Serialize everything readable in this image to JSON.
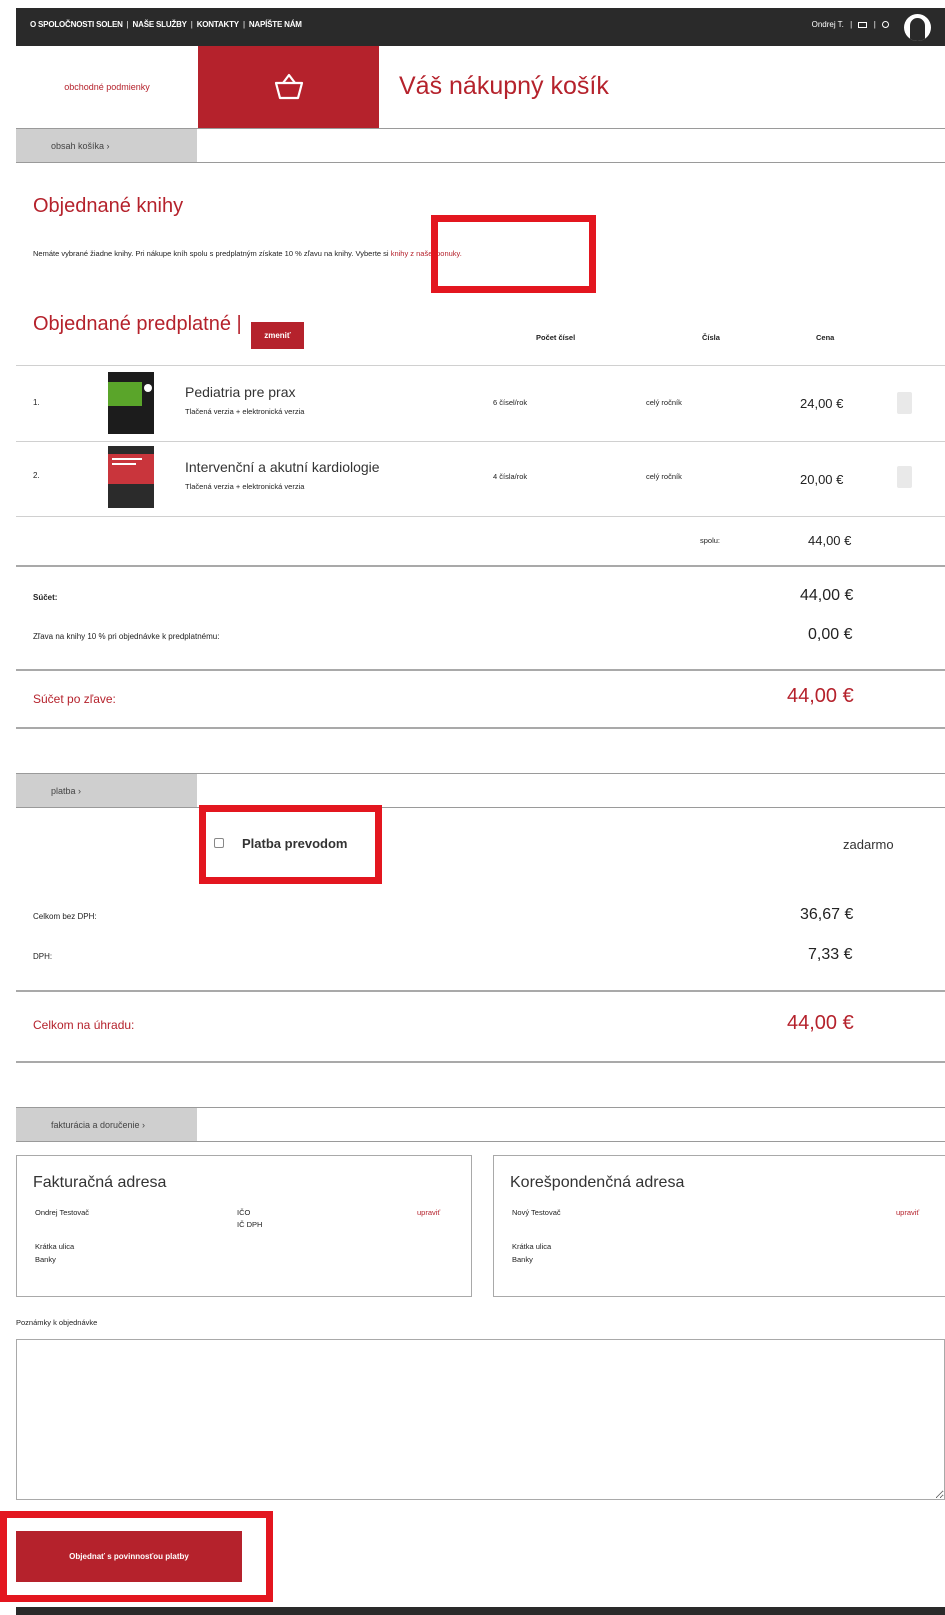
{
  "topbar": {
    "nav": [
      "O SPOLOČNOSTI SOLEN",
      "NAŠE SLUŽBY",
      "KONTAKTY",
      "NAPÍŠTE NÁM"
    ],
    "user": "Ondrej T.",
    "icons": [
      "cart-icon",
      "logout-icon"
    ],
    "separator": "|"
  },
  "header": {
    "terms_link": "obchodné podmienky",
    "title": "Váš nákupný košík"
  },
  "cart_tab": "obsah košíka ›",
  "books": {
    "title": "Objednané knihy",
    "notice_prefix": "Nemáte vybrané žiadne knihy. Pri nákupe kníh spolu s predplatným získate 10 % zľavu na knihy.",
    "notice_mid": "Vyberte si",
    "notice_link": "knihy z našej ponuky."
  },
  "subscriptions": {
    "title": "Objednané predplatné |",
    "change_button": "zmeniť",
    "columns": [
      "Počet čísel",
      "Čísla",
      "Cena"
    ],
    "items": [
      {
        "index": "1.",
        "name": "Pediatria pre prax",
        "variant": "Tlačená verzia + elektronická verzia",
        "issues": "6 čísel/rok",
        "numbers": "celý ročník",
        "price": "24,00 €"
      },
      {
        "index": "2.",
        "name": "Intervenční a akutní kardiologie",
        "variant": "Tlačená verzia + elektronická verzia",
        "issues": "4 čísla/rok",
        "numbers": "celý ročník",
        "price": "20,00 €"
      }
    ],
    "total_label": "spolu:",
    "total_value": "44,00 €"
  },
  "summary": {
    "sum_label": "Súčet:",
    "sum_value": "44,00 €",
    "discount_label": "Zľava na knihy 10 % pri objednávke k predplatnému:",
    "discount_value": "0,00 €",
    "after_label": "Súčet po zľave:",
    "after_value": "44,00 €"
  },
  "payment": {
    "tab": "platba ›",
    "option": "Platba prevodom",
    "option_price": "zadarmo",
    "no_vat_label": "Celkom bez DPH:",
    "no_vat_value": "36,67 €",
    "vat_label": "DPH:",
    "vat_value": "7,33 €",
    "total_label": "Celkom na úhradu:",
    "total_value": "44,00 €"
  },
  "billing": {
    "tab": "fakturácia a doručenie ›",
    "invoice": {
      "title": "Fakturačná adresa",
      "name": "Ondrej Testovač",
      "ico": "IČO",
      "ic_dph": "IČ DPH",
      "edit": "upraviť",
      "street": "Krátka ulica",
      "city": "Banky"
    },
    "correspondence": {
      "title": "Korešpondenčná adresa",
      "name": "Nový Testovač",
      "edit": "upraviť",
      "street": "Krátka ulica",
      "city": "Banky"
    },
    "notes_label": "Poznámky k objednávke"
  },
  "submit_button": "Objednať s povinnosťou platby",
  "colors": {
    "accent": "#b5222c",
    "highlight": "#e3161f",
    "dark": "#2a2a2a"
  }
}
